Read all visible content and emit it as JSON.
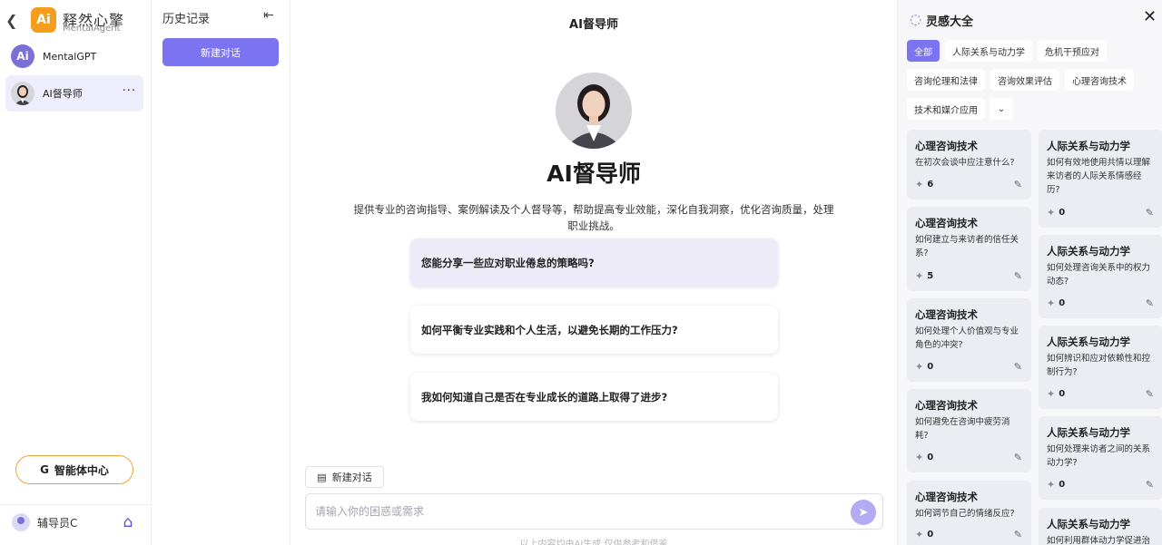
{
  "rail": {
    "brand_logo": "Ai",
    "brand_name": "释然心擎",
    "brand_sub": "MentalAgent",
    "agents": [
      {
        "label": "MentalGPT",
        "avatar": "Ai"
      },
      {
        "label": "AI督导师",
        "more": "···"
      }
    ],
    "center_button": "智能体中心",
    "center_icon": "G",
    "user_name": "辅导员C"
  },
  "history": {
    "title": "历史记录",
    "new_chat": "新建对话"
  },
  "main": {
    "header": "AI督导师",
    "hero_title": "AI督导师",
    "hero_desc": "提供专业的咨询指导、案例解读及个人督导等，帮助提高专业效能，深化自我洞察，优化咨询质量，处理职业挑战。",
    "suggestions": [
      "您能分享一些应对职业倦怠的策略吗?",
      "如何平衡专业实践和个人生活，以避免长期的工作压力?",
      "我如何知道自己是否在专业成长的道路上取得了进步?"
    ],
    "new_chat_small": "新建对话",
    "input_placeholder": "请输入你的困惑或需求",
    "disclaimer": "以上内容均由AI生成,仅供参考和借鉴"
  },
  "panel": {
    "title": "灵感大全",
    "chips": [
      "全部",
      "人际关系与动力学",
      "危机干预应对",
      "咨询伦理和法律",
      "咨询效果评估",
      "心理咨询技术",
      "技术和媒介应用"
    ],
    "expand": "⌄",
    "cards_left": [
      {
        "cat": "心理咨询技术",
        "q": "在初次会谈中应注意什么?",
        "count": "6"
      },
      {
        "cat": "心理咨询技术",
        "q": "如何建立与来访者的信任关系?",
        "count": "5"
      },
      {
        "cat": "心理咨询技术",
        "q": "如何处理个人价值观与专业角色的冲突?",
        "count": "0"
      },
      {
        "cat": "心理咨询技术",
        "q": "如何避免在咨询中疲劳消耗?",
        "count": "0"
      },
      {
        "cat": "心理咨询技术",
        "q": "如何调节自己的情绪反应?",
        "count": "0"
      }
    ],
    "cards_right": [
      {
        "cat": "人际关系与动力学",
        "q": "如何有效地使用共情以理解来访者的人际关系情感经历?",
        "count": "0"
      },
      {
        "cat": "人际关系与动力学",
        "q": "如何处理咨询关系中的权力动态?",
        "count": "0"
      },
      {
        "cat": "人际关系与动力学",
        "q": "如何辨识和应对依赖性和控制行为?",
        "count": "0"
      },
      {
        "cat": "人际关系与动力学",
        "q": "如何处理来访者之间的关系动力学?",
        "count": "0"
      },
      {
        "cat": "人际关系与动力学",
        "q": "如何利用群体动力学促进治",
        "count": ""
      }
    ]
  },
  "colors": {
    "accent": "#7b73f0",
    "brand_orange": "#f59d1d",
    "center_border": "#f2a23a",
    "panel_bg": "#f7f7f9",
    "card_bg": "#ecedf2"
  },
  "icons": [
    "back-arrow-icon",
    "collapse-icon",
    "more-icon",
    "home-icon",
    "send-icon",
    "chat-icon",
    "bulb-icon",
    "close-icon",
    "spark-icon",
    "edit-icon",
    "chevron-down-icon"
  ]
}
